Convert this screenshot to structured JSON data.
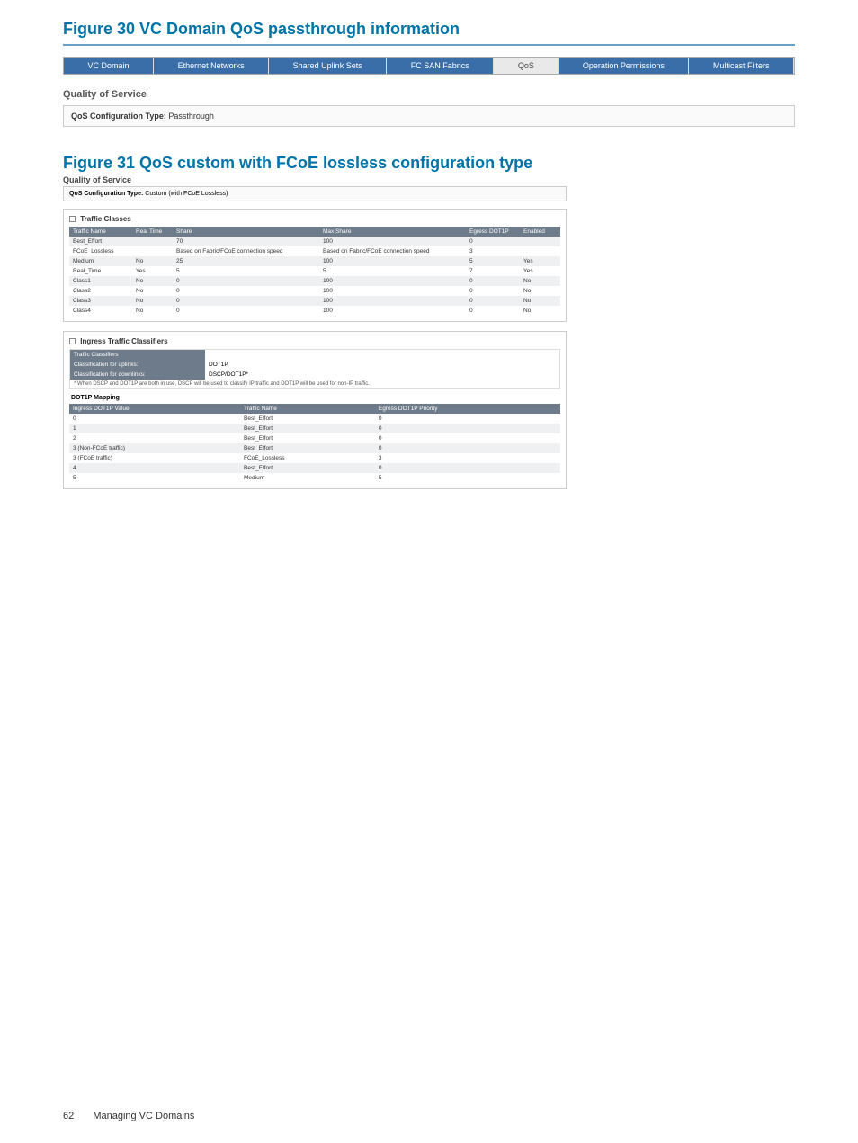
{
  "figure30": {
    "title": "Figure 30 VC Domain QoS passthrough information",
    "tabs": [
      "VC Domain",
      "Ethernet Networks",
      "Shared Uplink Sets",
      "FC SAN Fabrics",
      "QoS",
      "Operation Permissions",
      "Multicast Filters"
    ],
    "qos_heading": "Quality of Service",
    "config_label": "QoS Configuration Type:",
    "config_value": "Passthrough"
  },
  "figure31": {
    "title": "Figure 31 QoS custom with FCoE lossless configuration type",
    "qos_heading": "Quality of Service",
    "config_label": "QoS Configuration Type:",
    "config_value": "Custom (with FCoE Lossless)",
    "traffic_box_title": "Traffic Classes",
    "traffic_headers": [
      "Traffic Name",
      "Real Time",
      "Share",
      "Max Share",
      "Egress DOT1P",
      "Enabled"
    ],
    "traffic_rows": [
      {
        "name": "Best_Effort",
        "rt": "",
        "share": "70",
        "max": "100",
        "egress": "0",
        "enabled": ""
      },
      {
        "name": "FCoE_Lossless",
        "rt": "",
        "share": "Based on Fabric/FCoE connection speed",
        "max": "Based on Fabric/FCoE connection speed",
        "egress": "3",
        "enabled": ""
      },
      {
        "name": "Medium",
        "rt": "No",
        "share": "25",
        "max": "100",
        "egress": "5",
        "enabled": "Yes"
      },
      {
        "name": "Real_Time",
        "rt": "Yes",
        "share": "5",
        "max": "5",
        "egress": "7",
        "enabled": "Yes"
      },
      {
        "name": "Class1",
        "rt": "No",
        "share": "0",
        "max": "100",
        "egress": "0",
        "enabled": "No"
      },
      {
        "name": "Class2",
        "rt": "No",
        "share": "0",
        "max": "100",
        "egress": "0",
        "enabled": "No"
      },
      {
        "name": "Class3",
        "rt": "No",
        "share": "0",
        "max": "100",
        "egress": "0",
        "enabled": "No"
      },
      {
        "name": "Class4",
        "rt": "No",
        "share": "0",
        "max": "100",
        "egress": "0",
        "enabled": "No"
      }
    ],
    "ingress_box_title": "Ingress Traffic Classifiers",
    "classifiers_header": "Traffic Classifiers",
    "uplinks_label": "Classification for uplinks:",
    "uplinks_value": "DOT1P",
    "downlinks_label": "Classification for downlinks:",
    "downlinks_value": "DSCP/DOT1P*",
    "footnote": "* When DSCP and DOT1P are both in use, DSCP will be used to classify IP traffic and DOT1P will be used for non-IP traffic.",
    "dot1p_title": "DOT1P Mapping",
    "dot1p_headers": [
      "Ingress DOT1P Value",
      "Traffic Name",
      "Egress DOT1P Priority"
    ],
    "dot1p_rows": [
      {
        "ingress": "0",
        "tname": "Best_Effort",
        "prio": "0"
      },
      {
        "ingress": "1",
        "tname": "Best_Effort",
        "prio": "0"
      },
      {
        "ingress": "2",
        "tname": "Best_Effort",
        "prio": "0"
      },
      {
        "ingress": "3 (Non-FCoE traffic)",
        "tname": "Best_Effort",
        "prio": "0"
      },
      {
        "ingress": "3 (FCoE traffic)",
        "tname": "FCoE_Lossless",
        "prio": "3"
      },
      {
        "ingress": "4",
        "tname": "Best_Effort",
        "prio": "0"
      },
      {
        "ingress": "5",
        "tname": "Medium",
        "prio": "5"
      }
    ]
  },
  "footer": {
    "page_number": "62",
    "section": "Managing VC Domains"
  },
  "chart_data": {
    "type": "table",
    "tables": [
      {
        "title": "Traffic Classes",
        "columns": [
          "Traffic Name",
          "Real Time",
          "Share",
          "Max Share",
          "Egress DOT1P",
          "Enabled"
        ],
        "rows": [
          [
            "Best_Effort",
            "",
            "70",
            "100",
            "0",
            ""
          ],
          [
            "FCoE_Lossless",
            "",
            "Based on Fabric/FCoE connection speed",
            "Based on Fabric/FCoE connection speed",
            "3",
            ""
          ],
          [
            "Medium",
            "No",
            "25",
            "100",
            "5",
            "Yes"
          ],
          [
            "Real_Time",
            "Yes",
            "5",
            "5",
            "7",
            "Yes"
          ],
          [
            "Class1",
            "No",
            "0",
            "100",
            "0",
            "No"
          ],
          [
            "Class2",
            "No",
            "0",
            "100",
            "0",
            "No"
          ],
          [
            "Class3",
            "No",
            "0",
            "100",
            "0",
            "No"
          ],
          [
            "Class4",
            "No",
            "0",
            "100",
            "0",
            "No"
          ]
        ]
      },
      {
        "title": "DOT1P Mapping",
        "columns": [
          "Ingress DOT1P Value",
          "Traffic Name",
          "Egress DOT1P Priority"
        ],
        "rows": [
          [
            "0",
            "Best_Effort",
            "0"
          ],
          [
            "1",
            "Best_Effort",
            "0"
          ],
          [
            "2",
            "Best_Effort",
            "0"
          ],
          [
            "3 (Non-FCoE traffic)",
            "Best_Effort",
            "0"
          ],
          [
            "3 (FCoE traffic)",
            "FCoE_Lossless",
            "3"
          ],
          [
            "4",
            "Best_Effort",
            "0"
          ],
          [
            "5",
            "Medium",
            "5"
          ]
        ]
      }
    ]
  }
}
